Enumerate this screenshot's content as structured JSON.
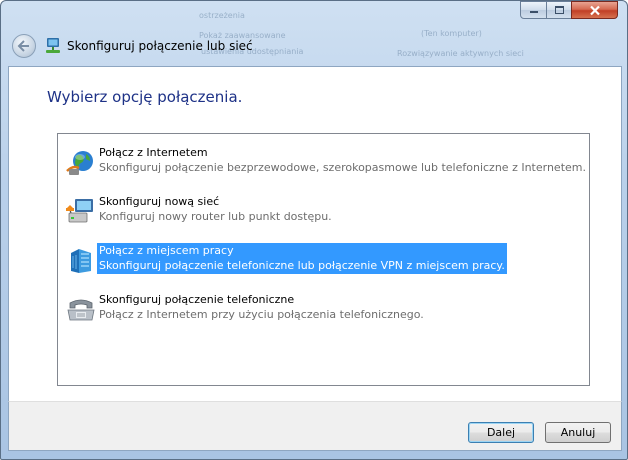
{
  "window": {
    "title": "Skonfiguruj połączenie lub sieć",
    "background_ghost_text": [
      "ostrzeżenia",
      "Pokaż zaawansowane",
      "ustawienia udostępniania",
      "(Ten komputer)",
      "Rozwiązywanie aktywnych sieci"
    ]
  },
  "main": {
    "heading": "Wybierz opcję połączenia.",
    "options": [
      {
        "title": "Połącz z Internetem",
        "description": "Skonfiguruj połączenie bezprzewodowe, szerokopasmowe lub telefoniczne z Internetem.",
        "icon": "globe-network-icon",
        "selected": false
      },
      {
        "title": "Skonfiguruj nową sieć",
        "description": "Konfiguruj nowy router lub punkt dostępu.",
        "icon": "network-setup-icon",
        "selected": false
      },
      {
        "title": "Połącz z miejscem pracy",
        "description": "Skonfiguruj połączenie telefoniczne lub połączenie VPN z miejscem pracy.",
        "icon": "workplace-building-icon",
        "selected": true
      },
      {
        "title": "Skonfiguruj połączenie telefoniczne",
        "description": "Połącz z Internetem przy użyciu połączenia telefonicznego.",
        "icon": "telephone-modem-icon",
        "selected": false
      }
    ]
  },
  "footer": {
    "next_label": "Dalej",
    "cancel_label": "Anuluj"
  },
  "colors": {
    "heading": "#1e3287",
    "selection": "#3399ff",
    "close_button": "#c13f26"
  }
}
